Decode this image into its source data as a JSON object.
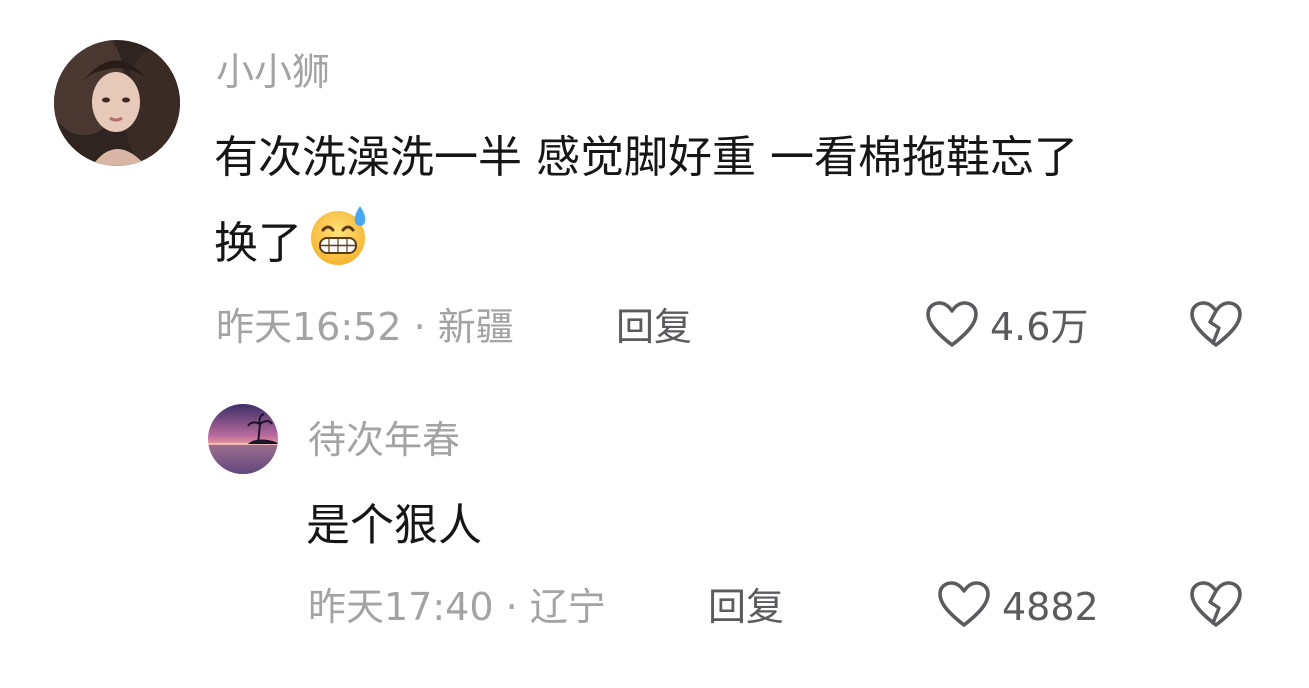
{
  "comments": [
    {
      "username": "小小狮",
      "text_line1": "有次洗澡洗一半 感觉脚好重 一看棉拖鞋忘了",
      "text_line2": "换了",
      "emoji": "grinning-face-with-sweat",
      "meta": "昨天16:52 · 新疆",
      "reply_label": "回复",
      "likes": "4.6万"
    },
    {
      "username": "待次年春",
      "text_line1": "是个狠人",
      "meta": "昨天17:40 · 辽宁",
      "reply_label": "回复",
      "likes": "4882"
    }
  ],
  "icons": {
    "like": "heart-outline-icon",
    "dislike": "broken-heart-icon"
  },
  "colors": {
    "text_primary": "#161616",
    "text_secondary": "#a3a3a6",
    "action": "#5b5b5f"
  }
}
